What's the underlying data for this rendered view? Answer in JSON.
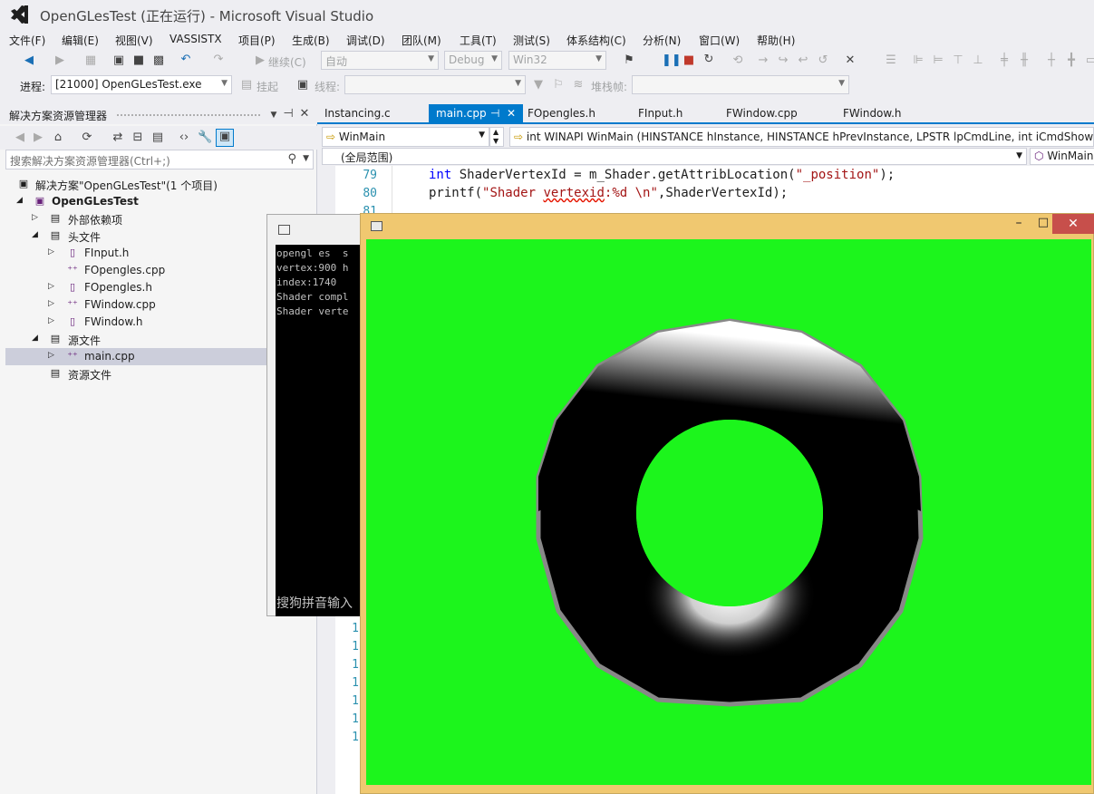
{
  "window": {
    "title": "OpenGLesTest (正在运行) - Microsoft Visual Studio"
  },
  "menu": [
    "文件(F)",
    "编辑(E)",
    "视图(V)",
    "VASSISTX",
    "项目(P)",
    "生成(B)",
    "调试(D)",
    "团队(M)",
    "工具(T)",
    "测试(S)",
    "体系结构(C)",
    "分析(N)",
    "窗口(W)",
    "帮助(H)"
  ],
  "toolbar": {
    "continue_label": "继续(C)",
    "solution_config": "自动",
    "build_config": "Debug",
    "platform": "Win32",
    "process_label": "进程:",
    "process_value": "[21000] OpenGLesTest.exe",
    "suspend_label": "挂起",
    "thread_label": "线程:",
    "stackframe_label": "堆栈帧:"
  },
  "solution_explorer": {
    "title": "解决方案资源管理器",
    "search_placeholder": "搜索解决方案资源管理器(Ctrl+;)",
    "tree": [
      {
        "label": "解决方案\"OpenGLesTest\"(1 个项目)",
        "icon": "solution-icon"
      },
      {
        "label": "OpenGLesTest",
        "icon": "project-icon",
        "bold": true
      },
      {
        "label": "外部依赖项",
        "icon": "dependencies-icon"
      },
      {
        "label": "头文件",
        "icon": "folder-icon"
      },
      {
        "label": "FInput.h",
        "icon": "header-file-icon"
      },
      {
        "label": "FOpengles.cpp",
        "icon": "cpp-file-icon"
      },
      {
        "label": "FOpengles.h",
        "icon": "header-file-icon"
      },
      {
        "label": "FWindow.cpp",
        "icon": "cpp-file-icon"
      },
      {
        "label": "FWindow.h",
        "icon": "header-file-icon"
      },
      {
        "label": "源文件",
        "icon": "folder-icon"
      },
      {
        "label": "main.cpp",
        "icon": "cpp-file-icon"
      },
      {
        "label": "资源文件",
        "icon": "folder-icon"
      }
    ]
  },
  "tabs": [
    "Instancing.c",
    "main.cpp",
    "FOpengles.h",
    "FInput.h",
    "FWindow.cpp",
    "FWindow.h"
  ],
  "navbar": {
    "function_scope": "WinMain",
    "signature": "int WINAPI WinMain (HINSTANCE hInstance, HINSTANCE hPrevInstance, LPSTR lpCmdLine, int iCmdShow)",
    "global_scope": "(全局范围)",
    "member": "WinMain"
  },
  "code": {
    "line_numbers": [
      "79",
      "80",
      "81"
    ],
    "lines": [
      {
        "kw": "int",
        "rest1": " ShaderVertexId = m_Shader.getAttribLocation(",
        "str": "\"_position\"",
        "rest2": ");"
      },
      {
        "pre": "printf(",
        "str1": "\"Shader ",
        "squig": "vertexid",
        "str2": ":%d \\n\"",
        "rest": ",ShaderVertexId);"
      }
    ],
    "partial_line_numbers": [
      "1",
      "1",
      "1",
      "1",
      "1",
      "1",
      "1"
    ]
  },
  "console": {
    "lines": [
      "opengl es  s",
      "vertex:900 h",
      "index:1740",
      "Shader compl",
      "Shader verte"
    ],
    "ime_text": "搜狗拼音输入"
  },
  "gl_window": {
    "minimize": "–",
    "maximize": "□",
    "close": "✕"
  },
  "colors": {
    "accent": "#007acc",
    "gl_background": "#1cf51c",
    "gl_frame": "#f0c870",
    "close_button": "#c74f4b"
  }
}
